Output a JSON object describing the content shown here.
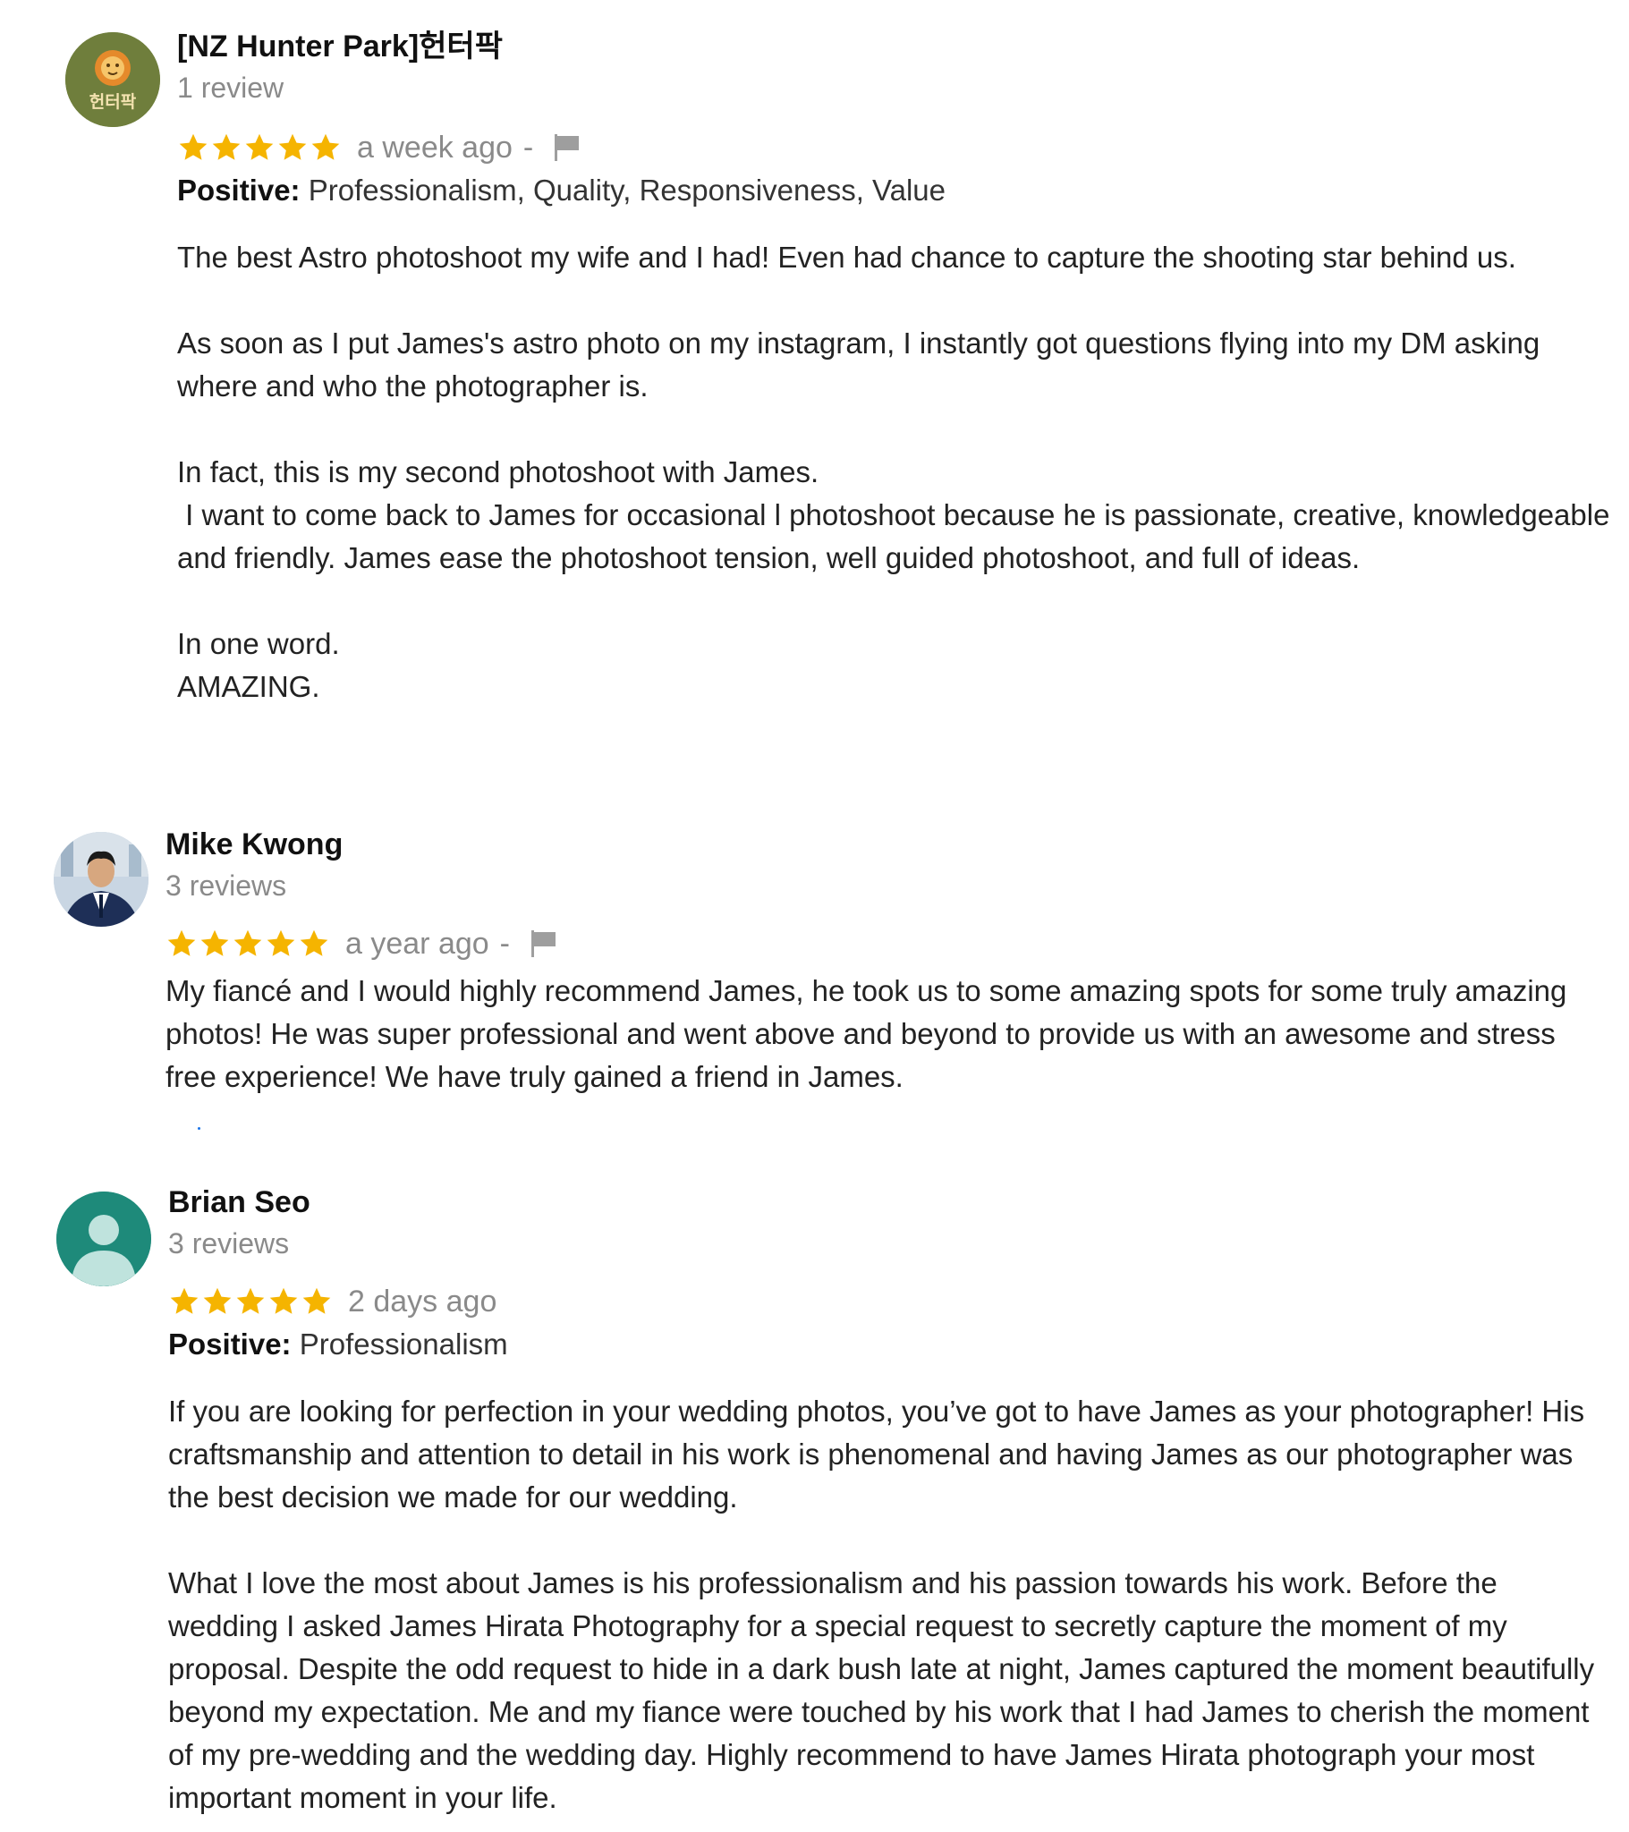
{
  "reviews": [
    {
      "reviewer": "[NZ Hunter Park]헌터팍",
      "review_count": "1 review",
      "avatar_text": "헌터팍",
      "rating": 5,
      "date": "a week ago",
      "separator": "-",
      "positive_label": "Positive:",
      "positive_tags": "Professionalism, Quality, Responsiveness, Value",
      "paragraphs": [
        "The best Astro photoshoot my wife and I had! Even had chance to capture the shooting star behind us.",
        "As soon as I put James's astro photo on my instagram, I instantly got questions flying into my DM asking where and who the photographer is.",
        "In fact, this is my second photoshoot with James.\n I want to come back to James for occasional l photoshoot because he is passionate, creative, knowledgeable and friendly. James ease the photoshoot tension, well guided photoshoot, and full of ideas.",
        "In one word.\nAMAZING."
      ]
    },
    {
      "reviewer": "Mike Kwong",
      "review_count": "3 reviews",
      "rating": 5,
      "date": "a year ago",
      "separator": "-",
      "paragraphs": [
        "My fiancé and I would highly recommend James, he took us to some amazing spots for some truly amazing photos! He was super professional and went above and beyond to provide us with an awesome and stress free experience! We have truly gained a friend in James."
      ]
    },
    {
      "reviewer": "Brian Seo",
      "review_count": "3 reviews",
      "rating": 5,
      "date": "2 days ago",
      "positive_label": "Positive:",
      "positive_tags": "Professionalism",
      "paragraphs": [
        "If you are looking for perfection in your wedding photos, you’ve got to have James as your photographer! His craftsmanship and attention to detail in his work is phenomenal and having James as our photographer was the best decision we made for our wedding.",
        "What I love the most about James is his professionalism and his passion towards his work. Before the wedding I asked James Hirata Photography for a special request to secretly capture the moment of my proposal. Despite the odd request to hide in a dark bush late at night, James captured the moment beautifully beyond my expectation. Me and my fiance were touched by his work that I had James to cherish the moment of my pre-wedding and the wedding day. Highly recommend to have James Hirata photograph your most important moment in your life."
      ]
    }
  ],
  "colors": {
    "star": "#f5b400",
    "muted_text": "#8a8a8a",
    "body_text": "#222222",
    "hunterpark_avatar_bg": "#6f7e3c",
    "default_avatar_bg": "#1e8a7a",
    "flag": "#9e9e9e"
  },
  "icons": {
    "star": "star-icon",
    "flag": "flag-icon",
    "default_avatar": "person-avatar-icon",
    "lion_logo": "lion-logo-icon"
  }
}
